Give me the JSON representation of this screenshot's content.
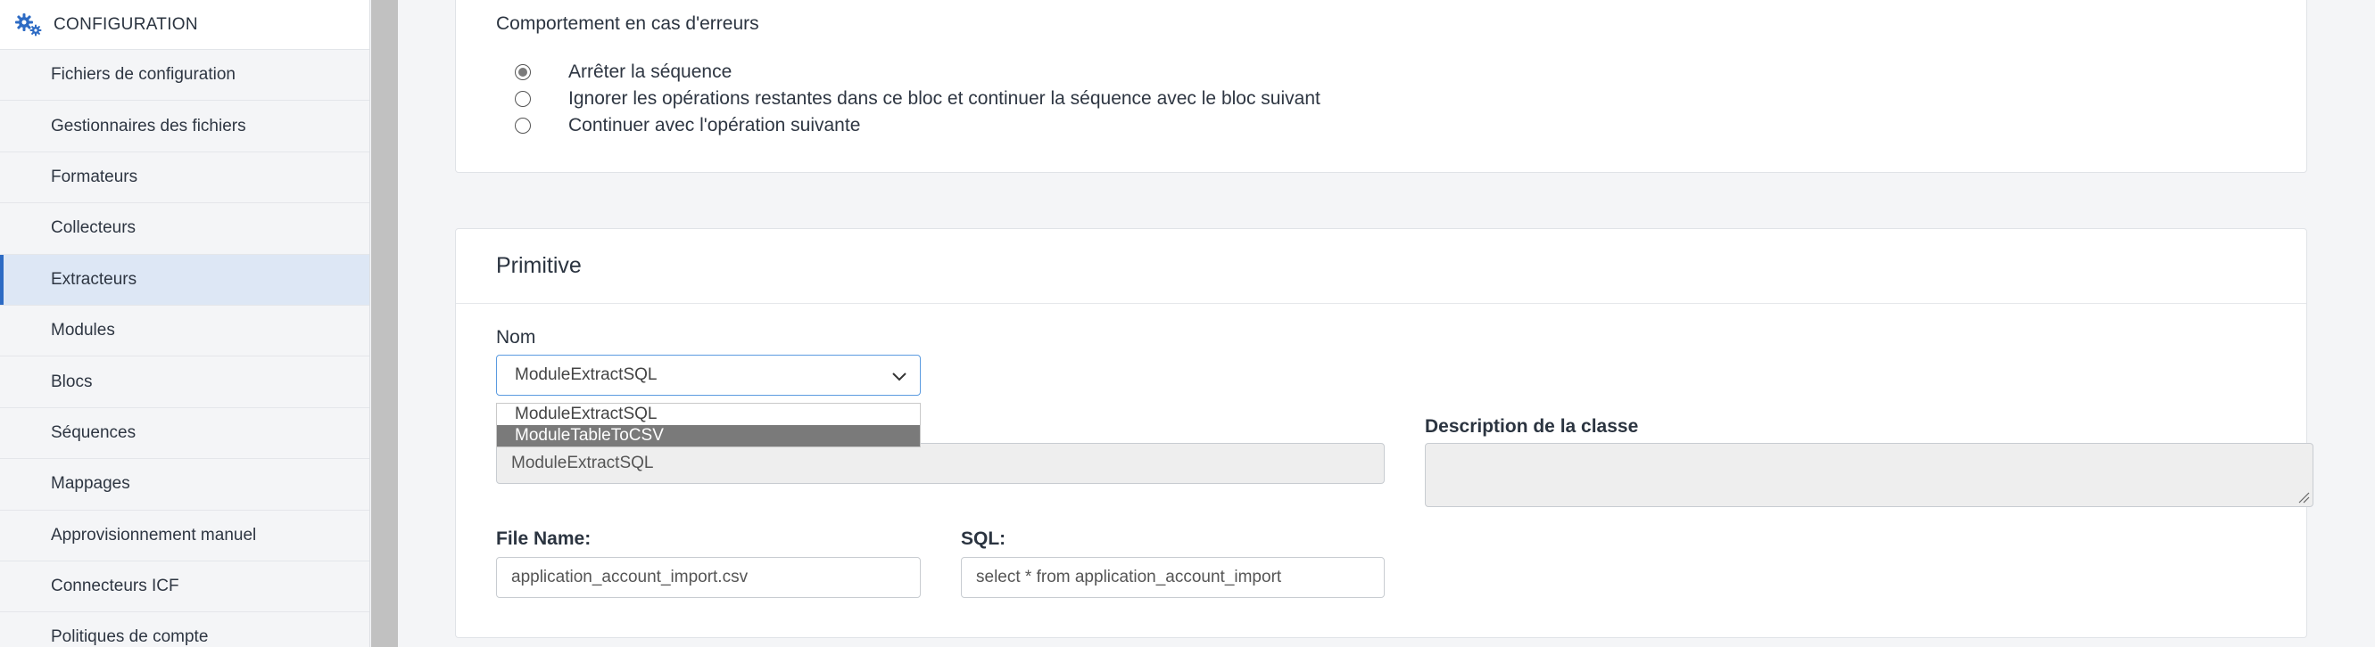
{
  "sidebar": {
    "section_label": "CONFIGURATION",
    "section_icon": "gears-icon",
    "items": [
      {
        "label": "Fichiers de configuration"
      },
      {
        "label": "Gestionnaires des fichiers"
      },
      {
        "label": "Formateurs"
      },
      {
        "label": "Collecteurs"
      },
      {
        "label": "Extracteurs",
        "active": true
      },
      {
        "label": "Modules"
      },
      {
        "label": "Blocs"
      },
      {
        "label": "Séquences"
      },
      {
        "label": "Mappages"
      },
      {
        "label": "Approvisionnement manuel"
      },
      {
        "label": "Connecteurs ICF"
      },
      {
        "label": "Politiques de compte"
      }
    ]
  },
  "errors": {
    "title": "Comportement en cas d'erreurs",
    "options": [
      {
        "label": "Arrêter la séquence",
        "checked": true
      },
      {
        "label": "Ignorer les opérations restantes dans ce bloc et continuer la séquence avec le bloc suivant",
        "checked": false
      },
      {
        "label": "Continuer avec l'opération suivante",
        "checked": false
      }
    ]
  },
  "primitive": {
    "title": "Primitive",
    "nom_label": "Nom",
    "nom_value": "ModuleExtractSQL",
    "dropdown_options": [
      {
        "label": "ModuleExtractSQL",
        "highlighted": false
      },
      {
        "label": "ModuleTableToCSV",
        "highlighted": true
      }
    ],
    "class_value": "ModuleExtractSQL",
    "description_label": "Description de la classe",
    "description_value": "",
    "file_name_label": "File Name:",
    "file_name_value": "application_account_import.csv",
    "sql_label": "SQL:",
    "sql_value": "select * from application_account_import"
  },
  "colors": {
    "accent": "#2d6bc4",
    "active_bg": "#dde7f5",
    "highlight": "#7a7a7a",
    "focus_border": "#5b9be0"
  }
}
